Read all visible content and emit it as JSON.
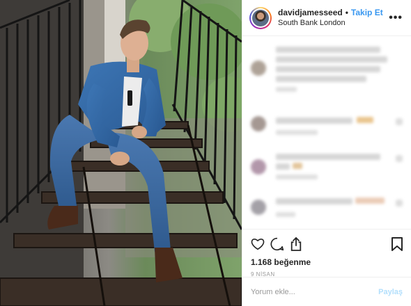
{
  "post": {
    "photo_alt": "man in denim sitting on metal stairs",
    "header": {
      "username": "davidjamesseed",
      "separator": "•",
      "follow_label": "Takip Et",
      "location": "South Bank London",
      "more_icon": "more-horizontal-icon"
    },
    "comments": {
      "blurred": true,
      "items": [
        {
          "avatar_color": "#9b8c7e",
          "lines": 4
        },
        {
          "avatar_color": "#8f7f78",
          "lines": 1,
          "emoji": true
        },
        {
          "avatar_color": "#a07e96",
          "lines": 2,
          "emoji": true
        },
        {
          "avatar_color": "#8e8a92",
          "lines": 1,
          "emoji": true
        }
      ]
    },
    "actions": {
      "like_icon": "heart-icon",
      "comment_icon": "comment-icon",
      "share_icon": "share-icon",
      "save_icon": "bookmark-icon",
      "likes_text": "1.168 beğenme",
      "date_text": "9 NİSAN"
    },
    "comment_box": {
      "placeholder": "Yorum ekle...",
      "post_label": "Paylaş"
    }
  },
  "colors": {
    "follow_blue": "#3897f0",
    "post_disabled": "#b2dffc",
    "text": "#262626",
    "muted": "#999999",
    "divider": "#efefef"
  }
}
